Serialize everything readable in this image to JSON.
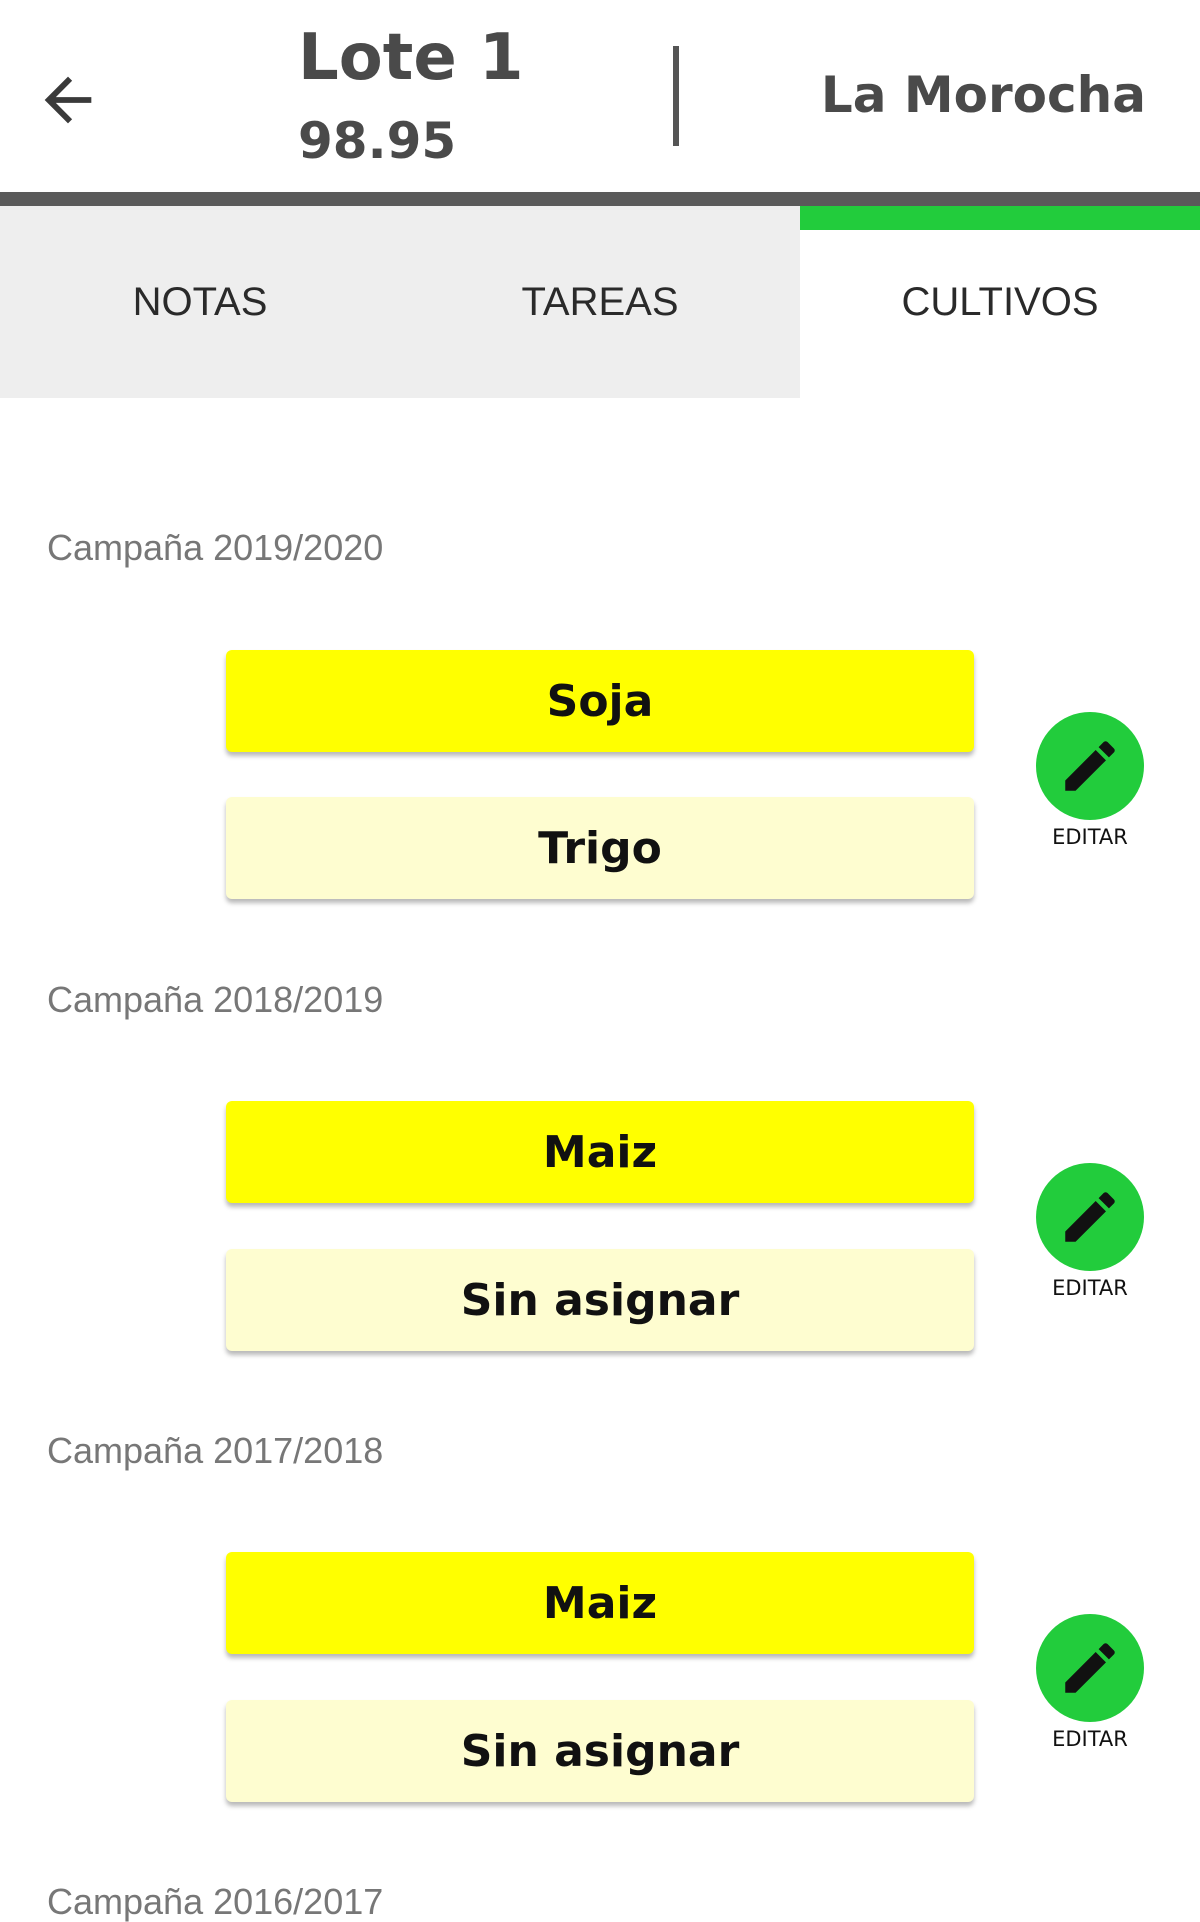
{
  "header": {
    "lot_title": "Lote 1",
    "lot_area": "98.95",
    "farm_name": "La Morocha"
  },
  "tabs": [
    {
      "label": "NOTAS",
      "active": false
    },
    {
      "label": "TAREAS",
      "active": false
    },
    {
      "label": "CULTIVOS",
      "active": true
    }
  ],
  "colors": {
    "accent_green": "#22cc3c",
    "primary_crop": "#ffff00",
    "secondary_crop": "#fefdd0",
    "tab_inactive_bg": "#eeeeee",
    "header_text": "#4a4a4a"
  },
  "icons": {
    "back": "arrow-left-icon",
    "edit": "pencil-icon"
  },
  "campaigns": [
    {
      "label": "Campaña 2019/2020",
      "primary_crop": "Soja",
      "secondary_crop": "Trigo",
      "edit_label": "EDITAR"
    },
    {
      "label": "Campaña 2018/2019",
      "primary_crop": "Maiz",
      "secondary_crop": "Sin asignar",
      "edit_label": "EDITAR"
    },
    {
      "label": "Campaña 2017/2018",
      "primary_crop": "Maiz",
      "secondary_crop": "Sin asignar",
      "edit_label": "EDITAR"
    },
    {
      "label": "Campaña 2016/2017"
    }
  ]
}
